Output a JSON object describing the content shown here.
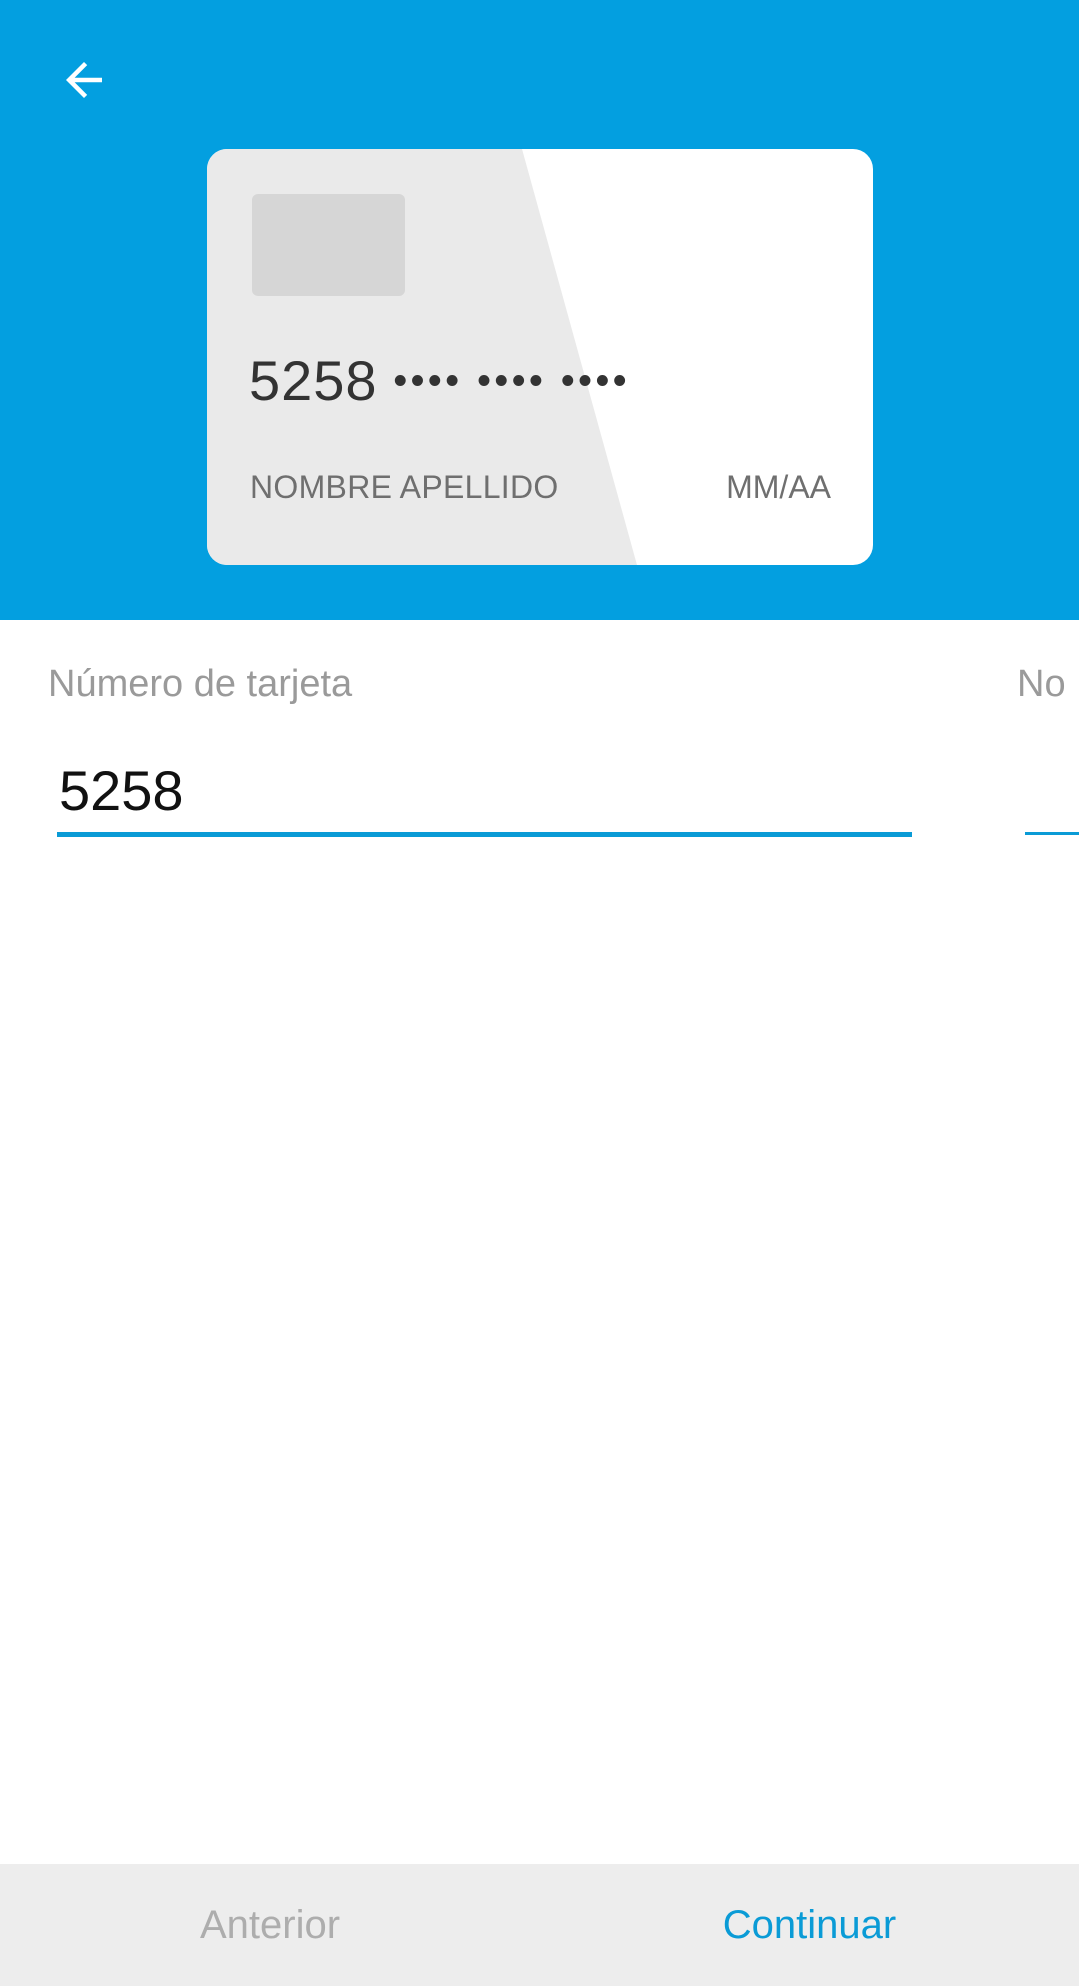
{
  "colors": {
    "header_bg": "#039FE0",
    "accent": "#0A9BD6",
    "footer_bg": "#EDEDED",
    "disabled_text": "#ADADAD"
  },
  "header": {
    "back_icon": "arrow-left-icon"
  },
  "card": {
    "number_first": "5258",
    "number_masked": "•••• •••• ••••",
    "holder_placeholder": "NOMBRE APELLIDO",
    "expiry_placeholder": "MM/AA"
  },
  "form": {
    "card_number_label": "Número de tarjeta",
    "card_number_value": "5258",
    "next_field_label_partial": "No"
  },
  "footer": {
    "prev_label": "Anterior",
    "next_label": "Continuar"
  }
}
